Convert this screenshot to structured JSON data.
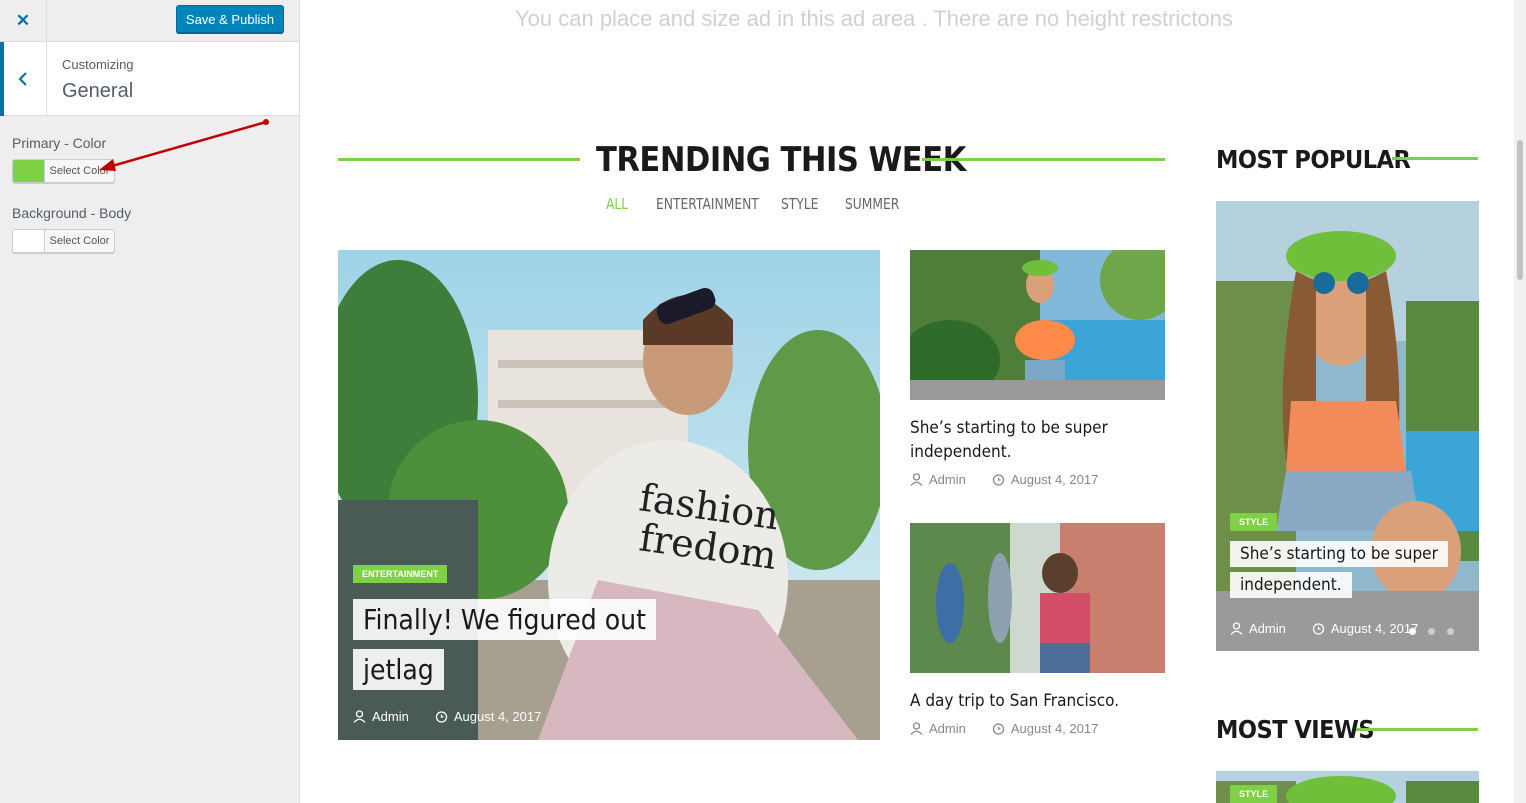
{
  "customizer": {
    "close_icon": "close-icon",
    "save_label": "Save & Publish",
    "breadcrumb": "Customizing",
    "panel_title": "General",
    "controls": [
      {
        "label": "Primary - Color",
        "button": "Select Color",
        "color": "#7ed144"
      },
      {
        "label": "Background - Body",
        "button": "Select Color",
        "color": "#ffffff"
      }
    ]
  },
  "preview": {
    "ad_text": "You can place and size ad in this ad area . There are no height restrictons",
    "trending": {
      "title": "TRENDING THIS WEEK",
      "tabs": [
        "ALL",
        "ENTERTAINMENT",
        "STYLE",
        "SUMMER"
      ],
      "active_tab": "ALL",
      "featured": {
        "badge": "ENTERTAINMENT",
        "title": "Finally! We figured out jetlag",
        "author": "Admin",
        "date": "August 4, 2017"
      },
      "posts": [
        {
          "title": "She’s starting to be super independent.",
          "author": "Admin",
          "date": "August 4, 2017"
        },
        {
          "title": "A day trip to San Francisco.",
          "author": "Admin",
          "date": "August 4, 2017"
        }
      ]
    },
    "most_popular": {
      "title": "MOST POPULAR",
      "badge": "STYLE",
      "post_title": "She’s starting to be super independent.",
      "author": "Admin",
      "date": "August 4, 2017"
    },
    "most_views": {
      "title": "MOST VIEWS",
      "badge": "STYLE"
    }
  },
  "colors": {
    "accent": "#7ed144",
    "wp_blue": "#0085ba",
    "annotation": "#c00000"
  }
}
